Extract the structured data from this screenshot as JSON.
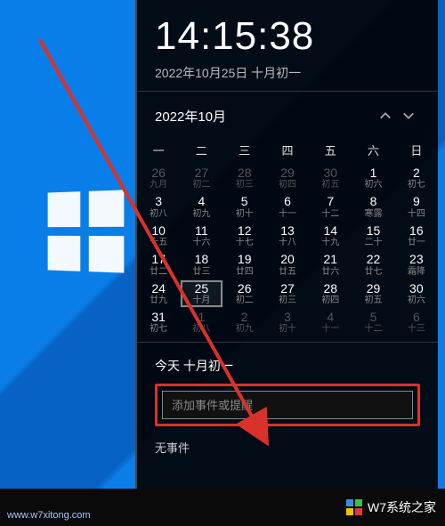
{
  "clock": {
    "time": "14:15:38",
    "date": "2022年10月25日 十月初一"
  },
  "month": {
    "label": "2022年10月"
  },
  "weekdays": [
    "一",
    "二",
    "三",
    "四",
    "五",
    "六",
    "日"
  ],
  "grid": [
    [
      {
        "n": "26",
        "s": "九月",
        "dim": true
      },
      {
        "n": "27",
        "s": "初二",
        "dim": true
      },
      {
        "n": "28",
        "s": "初三",
        "dim": true
      },
      {
        "n": "29",
        "s": "初四",
        "dim": true
      },
      {
        "n": "30",
        "s": "初五",
        "dim": true
      },
      {
        "n": "1",
        "s": "初六"
      },
      {
        "n": "2",
        "s": "初七"
      }
    ],
    [
      {
        "n": "3",
        "s": "初八"
      },
      {
        "n": "4",
        "s": "初九"
      },
      {
        "n": "5",
        "s": "初十"
      },
      {
        "n": "6",
        "s": "十一"
      },
      {
        "n": "7",
        "s": "十二"
      },
      {
        "n": "8",
        "s": "寒露"
      },
      {
        "n": "9",
        "s": "十四"
      }
    ],
    [
      {
        "n": "10",
        "s": "十五"
      },
      {
        "n": "11",
        "s": "十六"
      },
      {
        "n": "12",
        "s": "十七"
      },
      {
        "n": "13",
        "s": "十八"
      },
      {
        "n": "14",
        "s": "十九"
      },
      {
        "n": "15",
        "s": "二十"
      },
      {
        "n": "16",
        "s": "廿一"
      }
    ],
    [
      {
        "n": "17",
        "s": "廿二"
      },
      {
        "n": "18",
        "s": "廿三"
      },
      {
        "n": "19",
        "s": "廿四"
      },
      {
        "n": "20",
        "s": "廿五"
      },
      {
        "n": "21",
        "s": "廿六"
      },
      {
        "n": "22",
        "s": "廿七"
      },
      {
        "n": "23",
        "s": "霜降"
      }
    ],
    [
      {
        "n": "24",
        "s": "廿九"
      },
      {
        "n": "25",
        "s": "十月",
        "today": true
      },
      {
        "n": "26",
        "s": "初二"
      },
      {
        "n": "27",
        "s": "初三"
      },
      {
        "n": "28",
        "s": "初四"
      },
      {
        "n": "29",
        "s": "初五"
      },
      {
        "n": "30",
        "s": "初六"
      }
    ],
    [
      {
        "n": "31",
        "s": "初七"
      },
      {
        "n": "1",
        "s": "初八",
        "dim": true
      },
      {
        "n": "2",
        "s": "初九",
        "dim": true
      },
      {
        "n": "3",
        "s": "初十",
        "dim": true
      },
      {
        "n": "4",
        "s": "十一",
        "dim": true
      },
      {
        "n": "5",
        "s": "十二",
        "dim": true
      },
      {
        "n": "6",
        "s": "十三",
        "dim": true
      }
    ]
  ],
  "agenda": {
    "title": "今天 十月初一",
    "placeholder": "添加事件或提醒",
    "empty": "无事件"
  },
  "watermark": {
    "url": "www.w7xitong.com",
    "brand": "W7系统之家"
  }
}
